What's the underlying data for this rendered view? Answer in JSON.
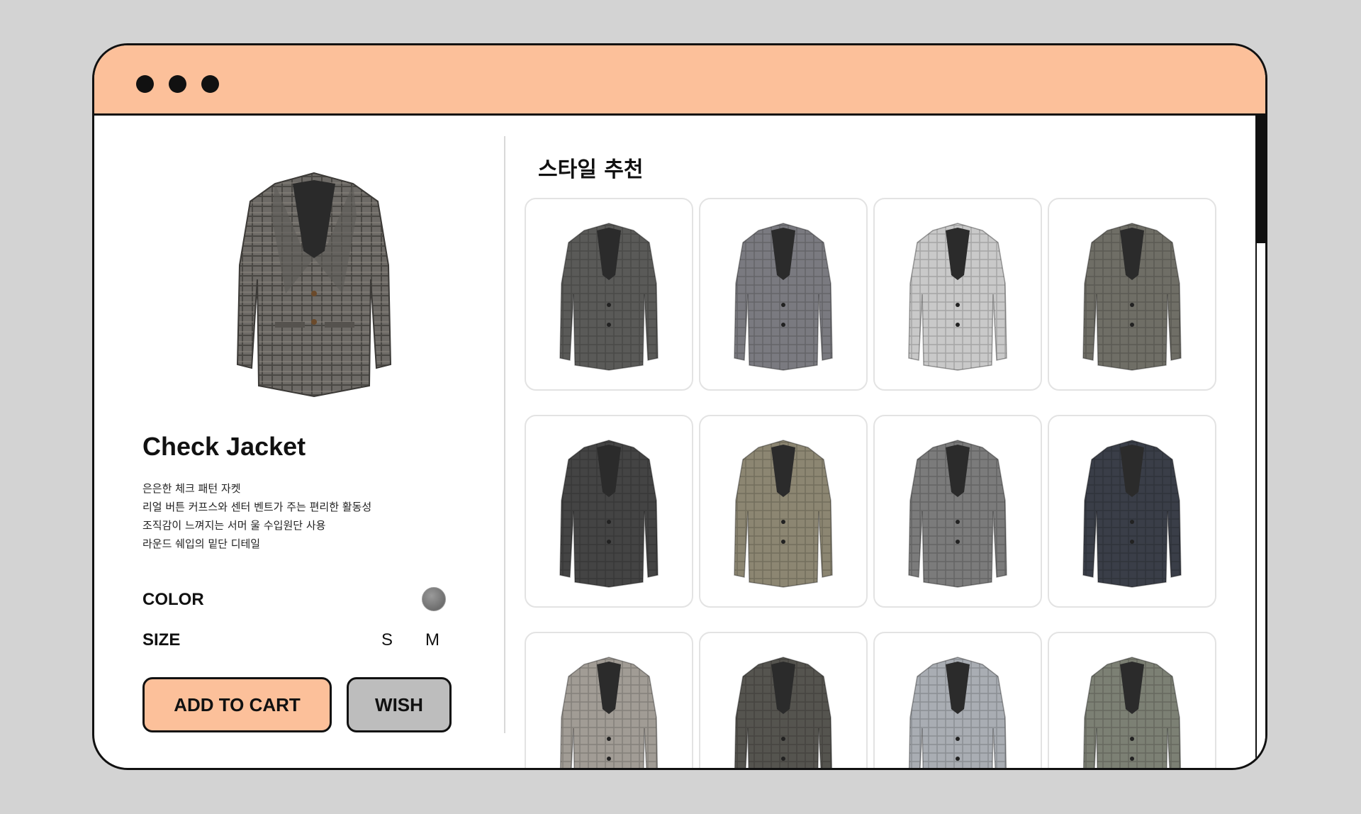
{
  "window": {
    "titlebar_color": "#fcc09a"
  },
  "product": {
    "title": "Check Jacket",
    "description": [
      "은은한 체크 패턴 자켓",
      "리얼 버튼 커프스와 센터 벤트가 주는 편리한 활동성",
      "조직감이 느껴지는 서머 울 수입원단 사용",
      "라운드 쉐입의 밑단 디테일"
    ],
    "color_label": "COLOR",
    "color_swatch": "#6e6e6e",
    "size_label": "SIZE",
    "sizes": [
      "S",
      "M"
    ],
    "add_to_cart_label": "ADD TO CART",
    "wish_label": "WISH"
  },
  "recommendations": {
    "title": "스타일 추천",
    "items": [
      {
        "icon": "jacket-image",
        "color": "#5a5a58"
      },
      {
        "icon": "jacket-image",
        "color": "#7a7a80"
      },
      {
        "icon": "jacket-image",
        "color": "#c9c9c9"
      },
      {
        "icon": "jacket-image",
        "color": "#6f6e66"
      },
      {
        "icon": "jacket-image",
        "color": "#444444"
      },
      {
        "icon": "jacket-image",
        "color": "#8c8672"
      },
      {
        "icon": "jacket-image",
        "color": "#7b7b7b"
      },
      {
        "icon": "jacket-image",
        "color": "#3a3e48"
      },
      {
        "icon": "jacket-image",
        "color": "#a19c95"
      },
      {
        "icon": "jacket-image",
        "color": "#55544f"
      },
      {
        "icon": "jacket-image",
        "color": "#a9adb3"
      },
      {
        "icon": "jacket-image",
        "color": "#7c8074"
      }
    ]
  }
}
